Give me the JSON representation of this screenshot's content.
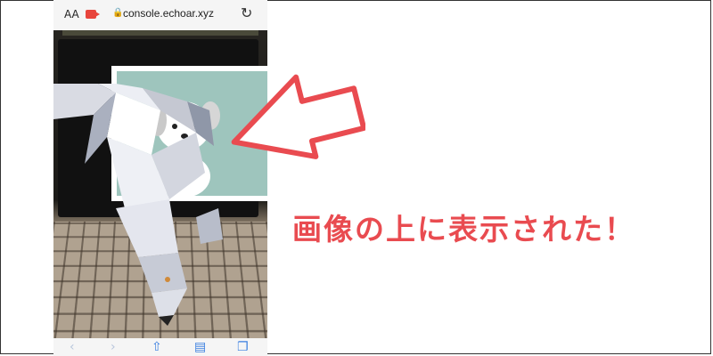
{
  "browser": {
    "text_size_label": "AA",
    "url": "console.echoar.xyz"
  },
  "icons": {
    "camera": "camera-icon",
    "lock": "lock-icon",
    "reload": "reload-icon",
    "back": "back-icon",
    "forward": "forward-icon",
    "share": "share-icon",
    "bookmarks": "bookmarks-icon",
    "tabs": "tabs-icon"
  },
  "caption": {
    "text": "画像の上に表示された！"
  },
  "colors": {
    "accent_red": "#e94b50",
    "camera_red": "#e8453c",
    "marker_bg": "#9ec5bd",
    "toolbar_blue": "#3b7fe0"
  }
}
